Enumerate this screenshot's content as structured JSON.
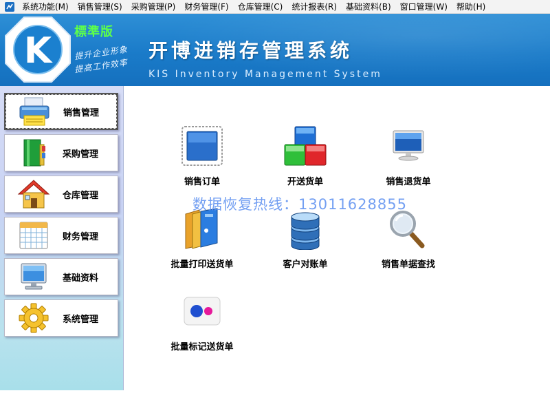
{
  "menubar": {
    "items": [
      "系统功能(M)",
      "销售管理(S)",
      "采购管理(P)",
      "财务管理(F)",
      "仓库管理(C)",
      "统计报表(R)",
      "基础资料(B)",
      "窗口管理(W)",
      "帮助(H)"
    ]
  },
  "banner": {
    "edition": "標準版",
    "slogan_line1": "提升企业形象",
    "slogan_line2": "提高工作效率",
    "title_cn": "开博进销存管理系统",
    "title_en": "KIS Inventory Management System",
    "logo_letter": "K"
  },
  "sidebar": {
    "items": [
      {
        "label": "销售管理",
        "icon": "printer-icon",
        "active": true
      },
      {
        "label": "采购管理",
        "icon": "books-icon"
      },
      {
        "label": "仓库管理",
        "icon": "house-icon"
      },
      {
        "label": "财务管理",
        "icon": "calendar-icon"
      },
      {
        "label": "基础资料",
        "icon": "monitor-icon"
      },
      {
        "label": "系统管理",
        "icon": "gear-icon"
      }
    ]
  },
  "main": {
    "tiles": [
      {
        "label": "销售订单",
        "icon": "stamp-icon"
      },
      {
        "label": "开送货单",
        "icon": "blocks-icon"
      },
      {
        "label": "销售退货单",
        "icon": "monitor-icon"
      },
      {
        "label": "批量打印送货单",
        "icon": "folders-icon"
      },
      {
        "label": "客户对账单",
        "icon": "database-icon"
      },
      {
        "label": "销售单据查找",
        "icon": "magnifier-icon"
      },
      {
        "label": "批量标记送货单",
        "icon": "flickr-dots-icon"
      }
    ]
  },
  "watermark": "数据恢复热线：13011628855",
  "colors": {
    "banner": "#1a7bc9",
    "edition_green": "#5dff4a",
    "sidebar_top": "#d6dcf6",
    "sidebar_bottom": "#a8dfea",
    "watermark": "#5b8ff0"
  }
}
